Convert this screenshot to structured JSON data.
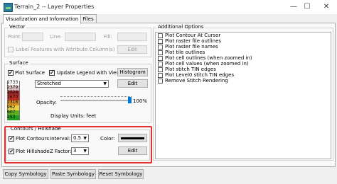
{
  "window": {
    "title": "Terrain_2 -- Layer Properties",
    "minimize": "—",
    "maximize": "☐",
    "close": "✕"
  },
  "tabs": [
    {
      "label": "Visualization and Information",
      "active": true
    },
    {
      "label": "Source Files",
      "active": false
    }
  ],
  "vector": {
    "group_label": "Vector",
    "point_label": "Point:",
    "line_label": "Line:",
    "fill_label": "Fill:",
    "label_features": "Label Features with Attribute Column(s)",
    "edit_label": "Edit"
  },
  "options": {
    "group_label": "Additional Options",
    "items": [
      "Plot Contour At Cursor",
      "Plot raster file outlines",
      "Plot raster file names",
      "Plot tile outlines",
      "Plot cell outlines (when zoomed in)",
      "Plot cell values (when zoomed in)",
      "Plot stitch TIN edges",
      "Plot Level0 stitch TIN edges",
      "Remove Stitch Rendering"
    ]
  },
  "surface": {
    "group_label": "Surface",
    "plot_surface": "Plot Surface",
    "update_legend": "Update Legend with View",
    "histogram_label": "Histogram",
    "style_value": "Stretched",
    "edit_label": "Edit",
    "opacity_label": "Opacity:",
    "opacity_value": "100%",
    "opacity_fraction": 1.0,
    "display_units": "Display Units: feet",
    "legend_values": [
      "2733",
      "2379",
      "2024",
      "1670",
      "1316",
      "962",
      "607",
      "253"
    ],
    "legend_colors": [
      "#ffffff",
      "#d8b8b8",
      "#9a2a2a",
      "#c03020",
      "#d89020",
      "#e8d040",
      "#60b020",
      "#20a020"
    ]
  },
  "contours": {
    "group_label": "Contours / Hillshade",
    "plot_contours": "Plot Contours",
    "interval_label": "Interval:",
    "interval_value": "0.5",
    "color_label": "Color:",
    "plot_hillshade": "Plot Hillshade",
    "zfactor_label": "Z Factor:",
    "zfactor_value": "3",
    "edit_label": "Edit",
    "color_value": "#000000"
  },
  "footer": {
    "copy_symbology": "Copy Symbology",
    "paste_symbology": "Paste Symbology",
    "reset_symbology": "Reset Symbology"
  }
}
